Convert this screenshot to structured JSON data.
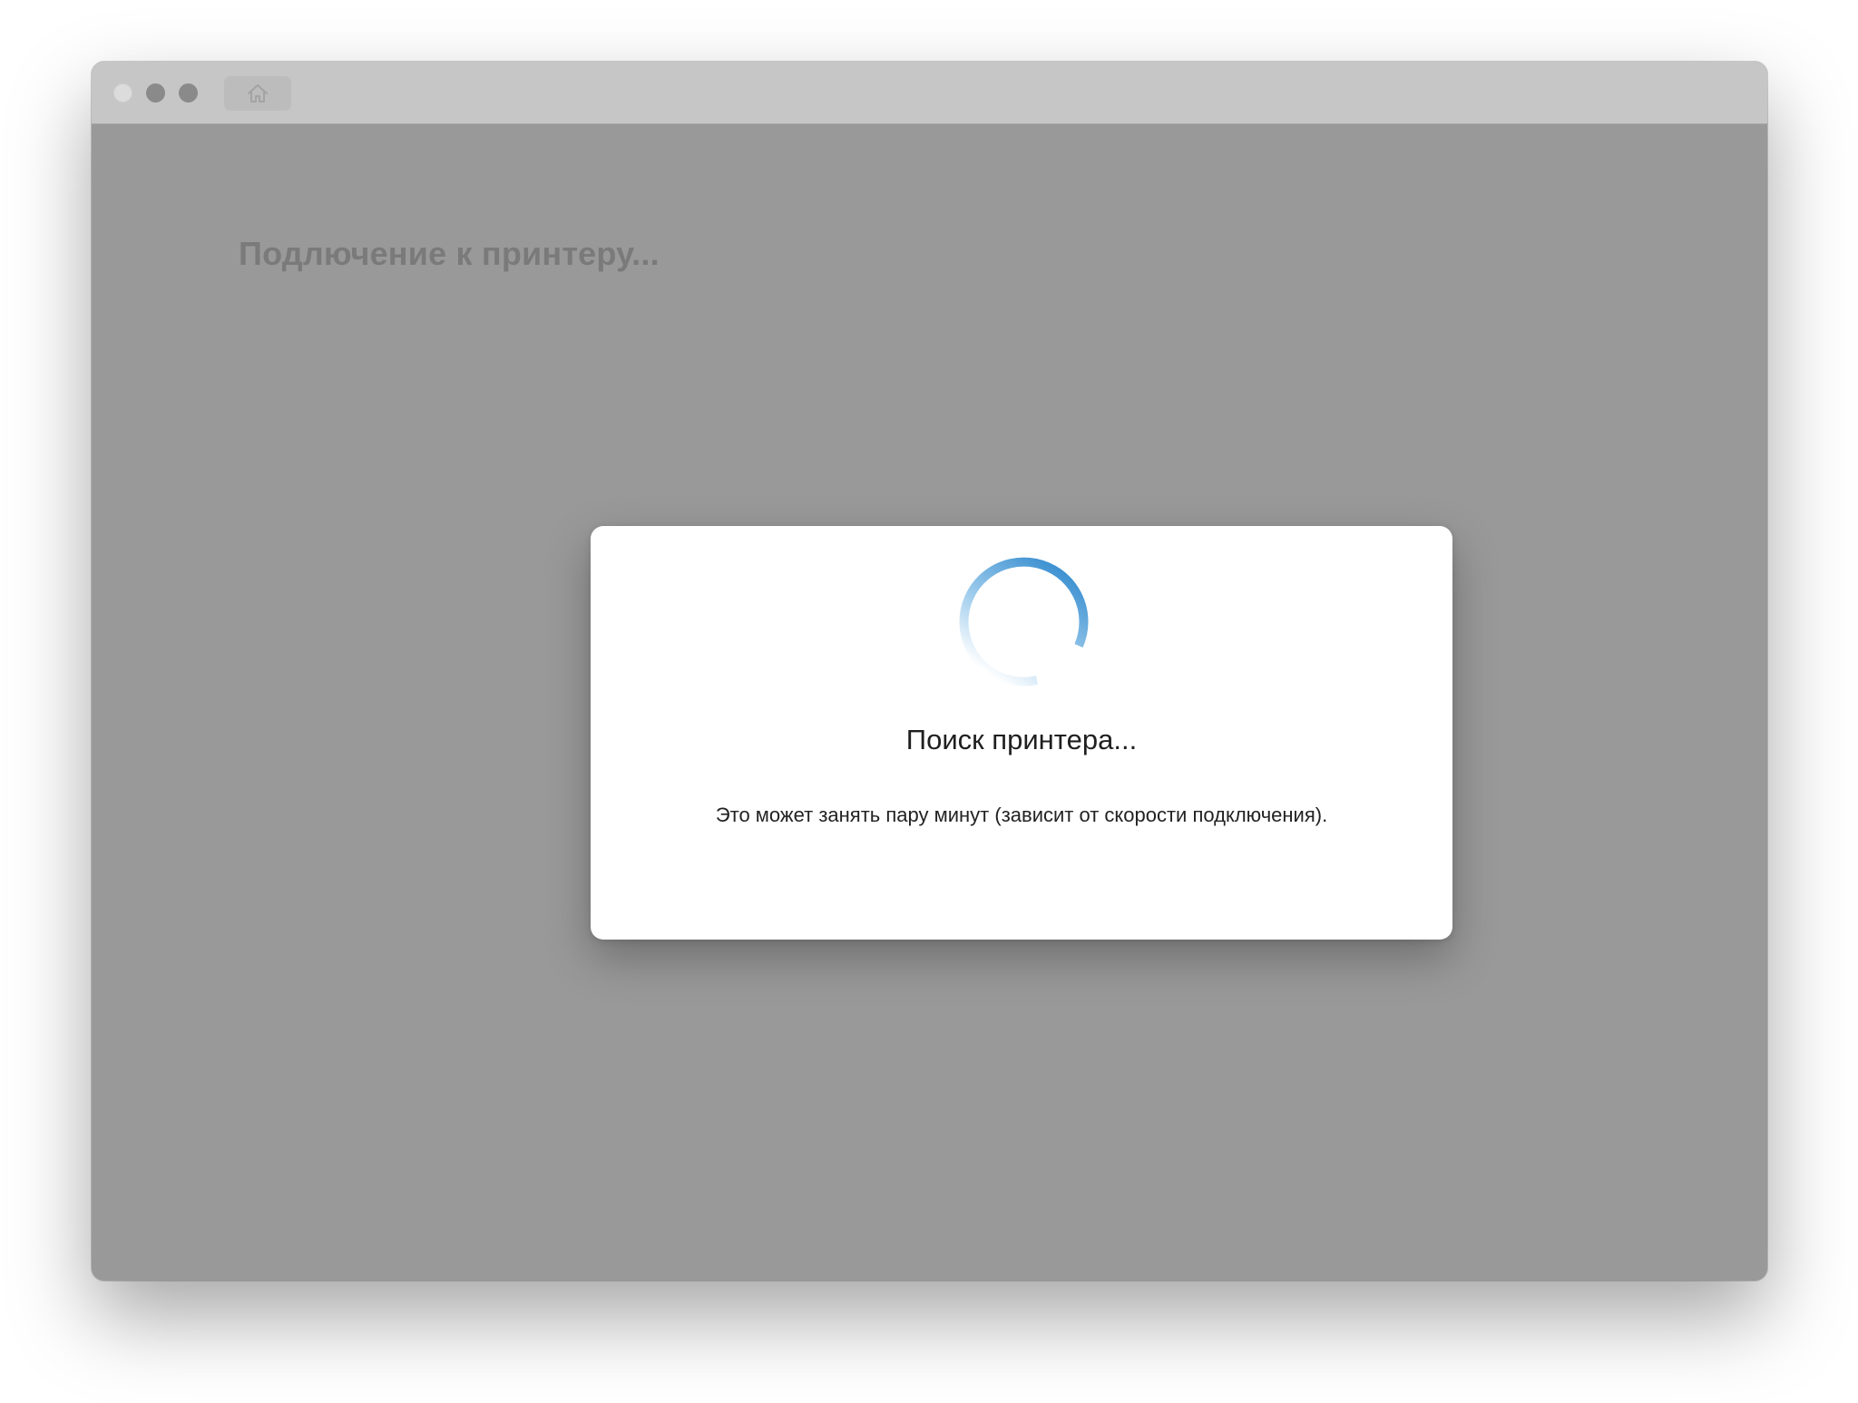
{
  "window": {
    "page_title": "Подлючение к принтеру..."
  },
  "titlebar": {
    "home_icon": "home-icon"
  },
  "dialog": {
    "title": "Поиск принтера...",
    "message": "Это может занять пару минут (зависит от скорости подключения).",
    "spinner_color": "#3a8fd0"
  }
}
